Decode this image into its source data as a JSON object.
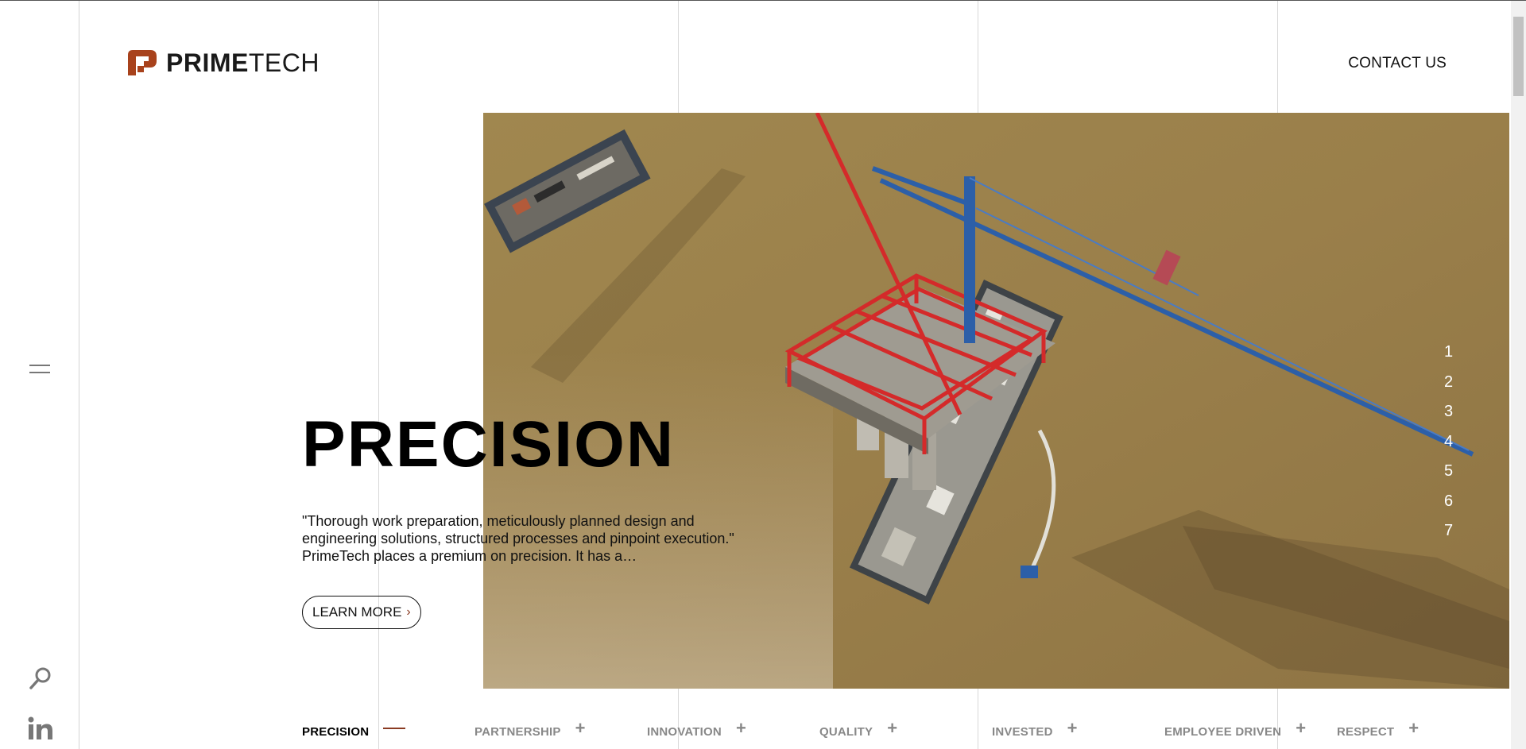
{
  "header": {
    "logo_bold": "PRIME",
    "logo_light": "TECH",
    "contact_label": "CONTACT US"
  },
  "hero": {
    "title": "PRECISION",
    "quote": "\"Thorough work preparation, meticulously planned design and engineering solutions, structured processes and pinpoint execution.\" PrimeTech places a premium on precision. It has a…",
    "learn_more": "LEARN MORE"
  },
  "slides": [
    "1",
    "2",
    "3",
    "4",
    "5",
    "6",
    "7"
  ],
  "tabs": [
    {
      "label": "PRECISION",
      "active": true
    },
    {
      "label": "PARTNERSHIP",
      "active": false
    },
    {
      "label": "INNOVATION",
      "active": false
    },
    {
      "label": "QUALITY",
      "active": false
    },
    {
      "label": "INVESTED",
      "active": false
    },
    {
      "label": "EMPLOYEE DRIVEN",
      "active": false
    },
    {
      "label": "RESPECT",
      "active": false
    }
  ],
  "icons": {
    "menu": "hamburger-icon",
    "search": "search-icon",
    "linkedin": "linkedin-icon",
    "logo_mark": "primetech-logo-icon"
  },
  "colors": {
    "accent": "#8a3b22",
    "water": "#9c8350",
    "crane": "#2c5fa8",
    "rig": "#d42a2a"
  }
}
